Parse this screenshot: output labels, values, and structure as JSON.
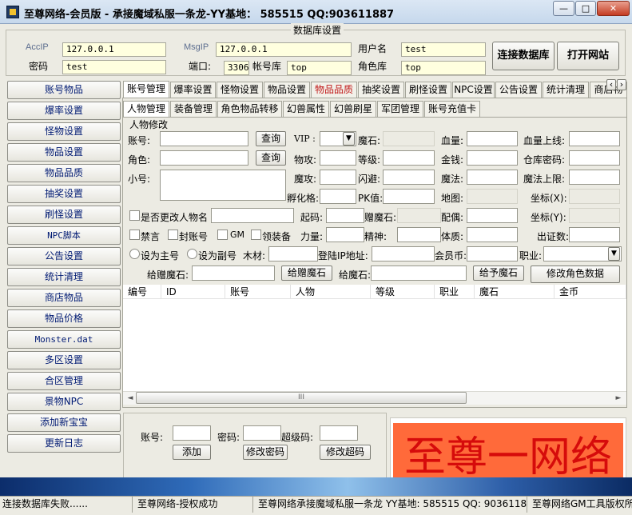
{
  "window": {
    "title": "至尊网络-会员版 - 承接魔域私服一条龙-YY基地： 585515   QQ:903611887",
    "minimize": "—",
    "maximize": "□",
    "close": "✕"
  },
  "db": {
    "group_title": "数据库设置",
    "acc_ip_label": "AccIP",
    "acc_ip": "127.0.0.1",
    "password_label": "密码",
    "password": "test",
    "msg_ip_label": "MsgIP",
    "msg_ip": "127.0.0.1",
    "port_label": "端口:",
    "port": "3306",
    "account_db_label": "帐号库",
    "account_db": "top",
    "username_label": "用户名",
    "username": "test",
    "role_db_label": "角色库",
    "role_db": "top",
    "connect_btn": "连接数据库",
    "open_site_btn": "打开网站"
  },
  "sidebar": {
    "items": [
      {
        "label": "账号物品"
      },
      {
        "label": "爆率设置"
      },
      {
        "label": "怪物设置"
      },
      {
        "label": "物品设置"
      },
      {
        "label": "物品品质"
      },
      {
        "label": "抽奖设置"
      },
      {
        "label": "刷怪设置"
      },
      {
        "label": "NPC脚本"
      },
      {
        "label": "公告设置"
      },
      {
        "label": "统计清理"
      },
      {
        "label": "商店物品"
      },
      {
        "label": "物品价格"
      },
      {
        "label": "Monster.dat"
      },
      {
        "label": "多区设置"
      },
      {
        "label": "合区管理"
      },
      {
        "label": "景物NPC"
      },
      {
        "label": "添加新宝宝"
      },
      {
        "label": "更新日志"
      }
    ]
  },
  "tabs": {
    "items": [
      {
        "label": "账号管理"
      },
      {
        "label": "爆率设置"
      },
      {
        "label": "怪物设置"
      },
      {
        "label": "物品设置"
      },
      {
        "label": "物品品质"
      },
      {
        "label": "抽奖设置"
      },
      {
        "label": "刷怪设置"
      },
      {
        "label": "NPC设置"
      },
      {
        "label": "公告设置"
      },
      {
        "label": "统计清理"
      },
      {
        "label": "商店物"
      }
    ],
    "scroll_left": "‹",
    "scroll_right": "›"
  },
  "subtabs": {
    "items": [
      {
        "label": "人物管理"
      },
      {
        "label": "装备管理"
      },
      {
        "label": "角色物品转移"
      },
      {
        "label": "幻兽属性"
      },
      {
        "label": "幻兽刷星"
      },
      {
        "label": "军团管理"
      },
      {
        "label": "账号充值卡"
      }
    ]
  },
  "form": {
    "group_title": "人物修改",
    "account": "账号:",
    "role": "角色:",
    "alt": "小号:",
    "query": "查询",
    "vip": "VIP :",
    "mojing": "魔石:",
    "hp": "血量:",
    "hp_max": "血量上线:",
    "wugong": "物攻:",
    "level": "等级:",
    "money": "金钱:",
    "warehouse_pwd": "仓库密码:",
    "mogong": "魔攻:",
    "dodge": "闪避:",
    "mana": "魔法:",
    "mana_max": "魔法上限:",
    "hatch": "孵化格:",
    "pk": "PK值:",
    "map": "地图:",
    "coord_x": "坐标(X):",
    "change_name": "是否更改人物名",
    "start_code": "起码:",
    "gift_mojing": "赠魔石:",
    "spouse": "配偶:",
    "coord_y": "坐标(Y):",
    "ban_speak": "禁言",
    "ban_account": "封账号",
    "gm": "GM",
    "equip": "领装备",
    "strength": "力量:",
    "spirit": "精神:",
    "physique": "体质:",
    "cert_count": "出证数:",
    "set_main": "设为主号",
    "set_alt": "设为副号",
    "wood": "木材:",
    "login_ip": "登陆IP地址:",
    "member_coin": "会员币:",
    "job": "职业:",
    "give_gift_mojing": "给赠魔石:",
    "give_gift_btn": "给赠魔石",
    "give_mojing": "给魔石:",
    "give_mojing_btn": "给予魔石",
    "modify_btn": "修改角色数据"
  },
  "grid": {
    "columns": [
      "编号",
      "ID",
      "账号",
      "人物",
      "等级",
      "职业",
      "魔石",
      "金币"
    ],
    "scroll_thumb": "III"
  },
  "bottom": {
    "account": "账号:",
    "password": "密码:",
    "super_code": "超级码:",
    "add_btn": "添加",
    "modify_pwd_btn": "修改密码",
    "modify_super_btn": "修改超码",
    "banner": "至尊一网络"
  },
  "status": {
    "s1": "连接数据库失败......",
    "s2": "至尊网络-授权成功",
    "s3": "至尊网络承接魔域私服一条龙 YY基地: 585515 QQ: 903611887",
    "s4": "至尊网络GM工具版权所有"
  },
  "colors": {
    "banner_bg": "#ff6a3a",
    "banner_fg": "#d60b0b",
    "sidebar_text": "#001a73"
  }
}
